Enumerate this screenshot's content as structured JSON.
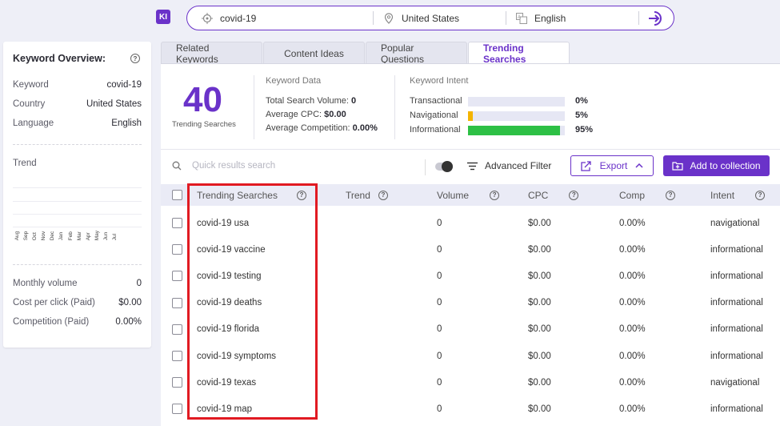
{
  "top": {
    "logo": "KI",
    "keyword": "covid-19",
    "country": "United States",
    "language": "English"
  },
  "overview": {
    "title": "Keyword Overview:",
    "rows": [
      {
        "label": "Keyword",
        "value": "covid-19"
      },
      {
        "label": "Country",
        "value": "United States"
      },
      {
        "label": "Language",
        "value": "English"
      }
    ],
    "trend_label": "Trend",
    "months": [
      "Aug",
      "Sep",
      "Oct",
      "Nov",
      "Dec",
      "Jan",
      "Feb",
      "Mar",
      "Apr",
      "May",
      "Jun",
      "Jul"
    ],
    "metrics": [
      {
        "label": "Monthly volume",
        "value": "0"
      },
      {
        "label": "Cost per click (Paid)",
        "value": "$0.00"
      },
      {
        "label": "Competition (Paid)",
        "value": "0.00%"
      }
    ]
  },
  "tabs": [
    "Related Keywords",
    "Content Ideas",
    "Popular Questions",
    "Trending Searches"
  ],
  "active_tab": "Trending Searches",
  "summary": {
    "count": "40",
    "count_label": "Trending Searches",
    "keyword_data_title": "Keyword Data",
    "total_volume_label": "Total Search Volume:",
    "total_volume": "0",
    "avg_cpc_label": "Average CPC:",
    "avg_cpc": "$0.00",
    "avg_comp_label": "Average Competition:",
    "avg_comp": "0.00%",
    "intent_title": "Keyword Intent",
    "intents": [
      {
        "label": "Transactional",
        "pct": "0%",
        "fraction": 0.0,
        "color": "#e6e7f4"
      },
      {
        "label": "Navigational",
        "pct": "5%",
        "fraction": 0.05,
        "color": "#f4b400"
      },
      {
        "label": "Informational",
        "pct": "95%",
        "fraction": 0.95,
        "color": "#2dc045"
      }
    ]
  },
  "toolbar": {
    "search_placeholder": "Quick results search",
    "advanced_filter": "Advanced Filter",
    "export": "Export",
    "add_collection": "Add to collection"
  },
  "table": {
    "headers": [
      "Trending Searches",
      "Trend",
      "Volume",
      "CPC",
      "Comp",
      "Intent"
    ],
    "rows": [
      {
        "kw": "covid-19 usa",
        "volume": "0",
        "cpc": "$0.00",
        "comp": "0.00%",
        "intent": "navigational"
      },
      {
        "kw": "covid-19 vaccine",
        "volume": "0",
        "cpc": "$0.00",
        "comp": "0.00%",
        "intent": "informational"
      },
      {
        "kw": "covid-19 testing",
        "volume": "0",
        "cpc": "$0.00",
        "comp": "0.00%",
        "intent": "informational"
      },
      {
        "kw": "covid-19 deaths",
        "volume": "0",
        "cpc": "$0.00",
        "comp": "0.00%",
        "intent": "informational"
      },
      {
        "kw": "covid-19 florida",
        "volume": "0",
        "cpc": "$0.00",
        "comp": "0.00%",
        "intent": "informational"
      },
      {
        "kw": "covid-19 symptoms",
        "volume": "0",
        "cpc": "$0.00",
        "comp": "0.00%",
        "intent": "informational"
      },
      {
        "kw": "covid-19 texas",
        "volume": "0",
        "cpc": "$0.00",
        "comp": "0.00%",
        "intent": "navigational"
      },
      {
        "kw": "covid-19 map",
        "volume": "0",
        "cpc": "$0.00",
        "comp": "0.00%",
        "intent": "informational"
      }
    ]
  },
  "colors": {
    "accent": "#6a32c9",
    "highlight": "#e11a22"
  }
}
